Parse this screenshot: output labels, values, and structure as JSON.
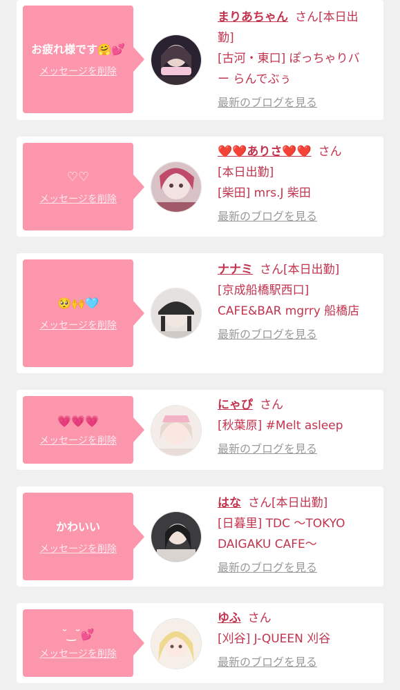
{
  "cards": [
    {
      "message": "お疲れ様です🤗💕",
      "delete_label": "メッセージを削除",
      "name": "まりあちゃん",
      "honorific": "さん",
      "status": "[本日出勤]",
      "shop": "[古河・東口] ぽっちゃりバー らんでぶぅ",
      "blog_link": "最新のブログを見る",
      "avatar_icon": "profile-photo-icon"
    },
    {
      "message": "♡♡",
      "delete_label": "メッセージを削除",
      "name": "❤️❤️ありさ❤️❤️",
      "honorific": "さん",
      "status": "[本日出勤]",
      "shop": "[柴田] mrs.J 柴田",
      "blog_link": "最新のブログを見る",
      "avatar_icon": "profile-photo-icon"
    },
    {
      "message": "🥺🙌🩵",
      "delete_label": "メッセージを削除",
      "name": "ナナミ",
      "honorific": "さん",
      "status": "[本日出勤]",
      "shop": "[京成船橋駅西口] CAFE&BAR mgrry 船橋店",
      "blog_link": "最新のブログを見る",
      "avatar_icon": "profile-photo-icon"
    },
    {
      "message": "💗💗💗",
      "delete_label": "メッセージを削除",
      "name": "にゃぴ",
      "honorific": "さん",
      "status": "",
      "shop": "[秋葉原] #Melt asleep",
      "blog_link": "最新のブログを見る",
      "avatar_icon": "profile-photo-icon"
    },
    {
      "message": "かわいい",
      "delete_label": "メッセージを削除",
      "name": "はな",
      "honorific": "さん",
      "status": "[本日出勤]",
      "shop": "[日暮里] TDC 〜TOKYO DAIGAKU CAFE〜",
      "blog_link": "最新のブログを見る",
      "avatar_icon": "profile-photo-icon"
    },
    {
      "message": "˘ ͜ ˘💕",
      "delete_label": "メッセージを削除",
      "name": "ゆふ",
      "honorific": "さん",
      "status": "",
      "shop": "[刈谷] J-QUEEN 刈谷",
      "blog_link": "最新のブログを見る",
      "avatar_icon": "profile-photo-icon"
    }
  ],
  "colors": {
    "accent": "#c2334d",
    "bubble": "#fb96ac",
    "muted": "#999999",
    "background": "#f0f0f0"
  }
}
